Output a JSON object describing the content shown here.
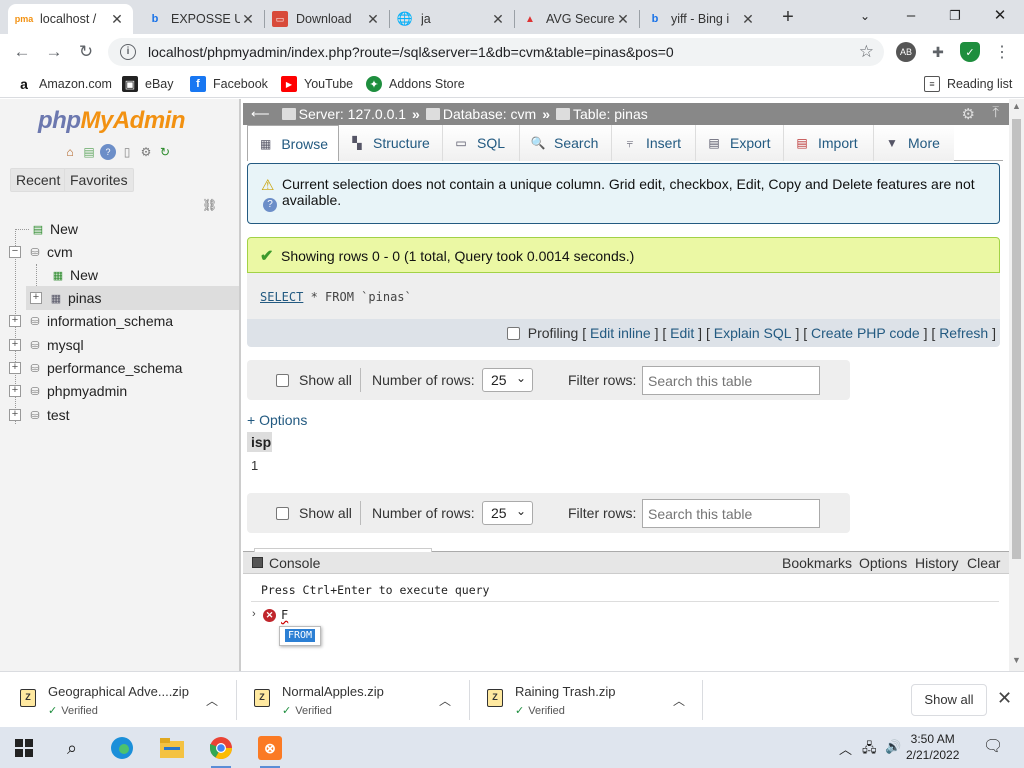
{
  "browser": {
    "tabs": [
      {
        "title": "localhost /",
        "icon": "phpmyadmin-icon"
      },
      {
        "title": "EXPOSSE U",
        "icon": "bing-icon"
      },
      {
        "title": "Download",
        "icon": "download-icon"
      },
      {
        "title": "ja",
        "icon": "globe-icon"
      },
      {
        "title": "AVG Secure",
        "icon": "avg-icon"
      },
      {
        "title": "yiff - Bing i",
        "icon": "bing-icon"
      }
    ],
    "url": "localhost/phpmyadmin/index.php?route=/sql&server=1&db=cvm&table=pinas&pos=0",
    "bookmarks": [
      "Amazon.com",
      "eBay",
      "Facebook",
      "YouTube",
      "Addons Store"
    ],
    "reading_list": "Reading list"
  },
  "pma": {
    "logo_php": "php",
    "logo_myadmin": "MyAdmin",
    "nav_tabs": [
      "Recent",
      "Favorites"
    ],
    "tree": {
      "new_root": "New",
      "db_cvm": "cvm",
      "new_table": "New",
      "table_pinas": "pinas",
      "databases": [
        "information_schema",
        "mysql",
        "performance_schema",
        "phpmyadmin",
        "test"
      ]
    },
    "breadcrumb": {
      "server": "Server: 127.0.0.1",
      "database": "Database: cvm",
      "table": "Table: pinas"
    },
    "menu": [
      "Browse",
      "Structure",
      "SQL",
      "Search",
      "Insert",
      "Export",
      "Import",
      "More"
    ],
    "notice": "Current selection does not contain a unique column. Grid edit, checkbox, Edit, Copy and Delete features are not available.",
    "success": "Showing rows 0 - 0 (1 total, Query took 0.0014 seconds.)",
    "sql": {
      "kw": "SELECT",
      "rest": "* FROM `pinas`"
    },
    "sql_links": {
      "profiling": "Profiling",
      "edit_inline": "Edit inline",
      "edit": "Edit",
      "explain": "Explain SQL",
      "create_php": "Create PHP code",
      "refresh": "Refresh"
    },
    "navigation": {
      "show_all": "Show all",
      "rows_label": "Number of rows:",
      "rows_value": "25",
      "filter_label": "Filter rows:",
      "search_placeholder": "Search this table"
    },
    "options": "+ Options",
    "table": {
      "column": "isp",
      "value": "1"
    },
    "console": {
      "title": "Console",
      "links": [
        "Bookmarks",
        "Options",
        "History",
        "Clear"
      ],
      "hint": "Press Ctrl+Enter to execute query",
      "typed": "F",
      "suggestion": "FROM"
    }
  },
  "downloads": {
    "items": [
      {
        "name": "Geographical Adve....zip",
        "status": "Verified"
      },
      {
        "name": "NormalApples.zip",
        "status": "Verified"
      },
      {
        "name": "Raining Trash.zip",
        "status": "Verified"
      }
    ],
    "show_all": "Show all"
  },
  "taskbar": {
    "time": "3:50 AM",
    "date": "2/21/2022"
  },
  "colors": {
    "link": "#235a81",
    "success_bg": "#ebf8a4",
    "breadcrumb_bg": "#888888",
    "logo_php": "#6c78af",
    "logo_myadmin": "#f29111"
  }
}
